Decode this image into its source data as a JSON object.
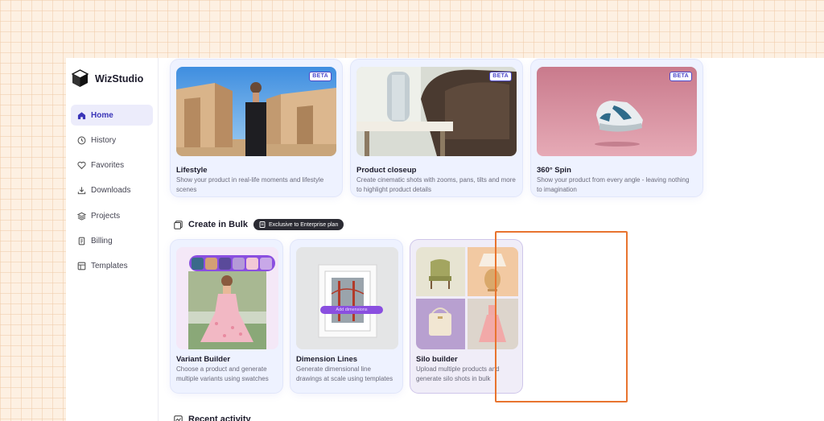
{
  "app": {
    "name": "WizStudio"
  },
  "sidebar": {
    "items": [
      {
        "label": "Home",
        "icon": "home-icon",
        "active": true
      },
      {
        "label": "History",
        "icon": "clock-icon"
      },
      {
        "label": "Favorites",
        "icon": "heart-icon"
      },
      {
        "label": "Downloads",
        "icon": "download-icon"
      },
      {
        "label": "Projects",
        "icon": "layers-icon"
      },
      {
        "label": "Billing",
        "icon": "receipt-icon"
      },
      {
        "label": "Templates",
        "icon": "template-icon"
      }
    ]
  },
  "create_cards": [
    {
      "title": "Lifestyle",
      "desc": "Show your product in real-life moments and lifestyle scenes",
      "badge": "BETA"
    },
    {
      "title": "Product closeup",
      "desc": "Create cinematic shots with zooms, pans, tilts and more to highlight product details",
      "badge": "BETA"
    },
    {
      "title": "360° Spin",
      "desc": "Show your product from every angle - leaving nothing to imagination",
      "badge": "BETA"
    }
  ],
  "bulk": {
    "title": "Create in Bulk",
    "badge": "Exclusive to Enterprise plan",
    "cards": [
      {
        "title": "Variant Builder",
        "desc": "Choose a product and generate multiple variants using swatches"
      },
      {
        "title": "Dimension Lines",
        "desc": "Generate dimensional line drawings at scale using templates",
        "pill": "Add dimensions"
      },
      {
        "title": "Silo builder",
        "desc": "Upload multiple products and generate silo shots in bulk"
      }
    ]
  },
  "recent": {
    "title": "Recent activity"
  },
  "colors": {
    "accent": "#4b47c9",
    "highlight": "#e8742f",
    "swatch_bar": "#8a4fe0"
  }
}
